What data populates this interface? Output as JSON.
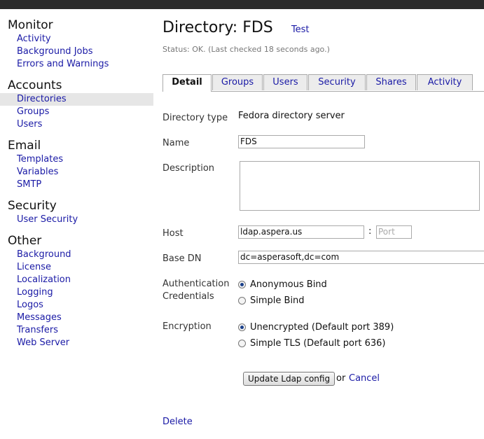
{
  "sidebar": {
    "sections": [
      {
        "title": "Monitor",
        "items": [
          "Activity",
          "Background Jobs",
          "Errors and Warnings"
        ]
      },
      {
        "title": "Accounts",
        "items": [
          "Directories",
          "Groups",
          "Users"
        ]
      },
      {
        "title": "Email",
        "items": [
          "Templates",
          "Variables",
          "SMTP"
        ]
      },
      {
        "title": "Security",
        "items": [
          "User Security"
        ]
      },
      {
        "title": "Other",
        "items": [
          "Background",
          "License",
          "Localization",
          "Logging",
          "Logos",
          "Messages",
          "Transfers",
          "Web Server"
        ]
      }
    ],
    "active_item": "Directories"
  },
  "header": {
    "title": "Directory: FDS",
    "test_link": "Test",
    "status": "Status: OK. (Last checked 18 seconds ago.)"
  },
  "tabs": {
    "items": [
      "Detail",
      "Groups",
      "Users",
      "Security",
      "Shares",
      "Activity"
    ],
    "active": "Detail"
  },
  "form": {
    "directory_type_label": "Directory type",
    "directory_type_value": "Fedora directory server",
    "name_label": "Name",
    "name_value": "FDS",
    "description_label": "Description",
    "description_value": "",
    "host_label": "Host",
    "host_value": "ldap.aspera.us",
    "host_sep": ":",
    "port_placeholder": "Port",
    "base_dn_label": "Base DN",
    "base_dn_value": "dc=asperasoft,dc=com",
    "auth_label_line1": "Authentication",
    "auth_label_line2": "Credentials",
    "auth_options": [
      "Anonymous Bind",
      "Simple Bind"
    ],
    "auth_selected": "Anonymous Bind",
    "encryption_label": "Encryption",
    "encryption_options": [
      "Unencrypted (Default port 389)",
      "Simple TLS (Default port 636)"
    ],
    "encryption_selected": "Unencrypted (Default port 389)",
    "update_button": "Update Ldap config",
    "or_text": "or",
    "cancel_link": "Cancel",
    "delete_link": "Delete"
  }
}
